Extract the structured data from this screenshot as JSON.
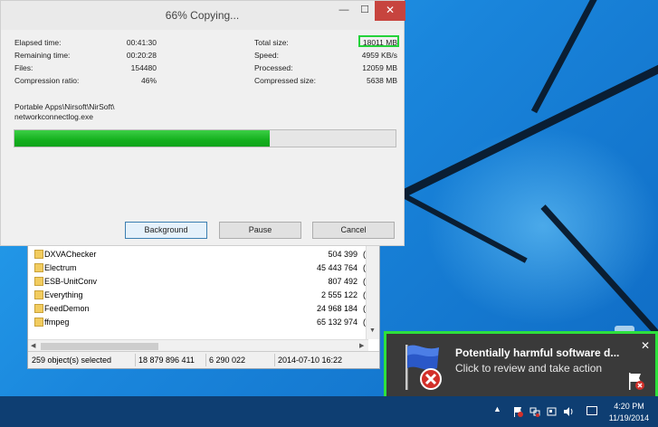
{
  "dialog": {
    "title": "66% Copying...",
    "minimize": "—",
    "maximize": "☐",
    "close": "✕",
    "stats_left": [
      {
        "label": "Elapsed time:",
        "value": "00:41:30"
      },
      {
        "label": "Remaining time:",
        "value": "00:20:28"
      },
      {
        "label": "Files:",
        "value": "154480"
      },
      {
        "label": "Compression ratio:",
        "value": "46%"
      }
    ],
    "stats_right": [
      {
        "label": "Total size:",
        "value": "18011 MB"
      },
      {
        "label": "Speed:",
        "value": "4959 KB/s"
      },
      {
        "label": "Processed:",
        "value": "12059 MB"
      },
      {
        "label": "Compressed size:",
        "value": "5638 MB"
      }
    ],
    "path_line1": "Portable Apps\\Nirsoft\\NirSoft\\",
    "path_line2": "networkconnectlog.exe",
    "progress_fraction": 0.67,
    "progress_color": "#14b01e",
    "highlight_color": "#24d23a",
    "buttons": {
      "background": "Background",
      "pause": "Pause",
      "cancel": "Cancel"
    }
  },
  "explorer": {
    "files": [
      {
        "name": "DXVAChecker",
        "size": "504 399",
        "extra": "("
      },
      {
        "name": "Electrum",
        "size": "45 443 764",
        "extra": "("
      },
      {
        "name": "ESB-UnitConv",
        "size": "807 492",
        "extra": "("
      },
      {
        "name": "Everything",
        "size": "2 555 122",
        "extra": "("
      },
      {
        "name": "FeedDemon",
        "size": "24 968 184",
        "extra": "("
      },
      {
        "name": "ffmpeg",
        "size": "65 132 974",
        "extra": "("
      }
    ],
    "status": {
      "selected": "259 object(s) selected",
      "size": "18 879 896 411",
      "packed": "6 290 022",
      "date": "2014-07-10 16:22"
    }
  },
  "toast": {
    "title": "Potentially harmful software d...",
    "message": "Click to review and take action",
    "close": "✕",
    "border_color": "#2ee03c",
    "icon": "action-center-flag-icon"
  },
  "taskbar": {
    "time": "4:20 PM",
    "date": "11/19/2014",
    "chevron": "▲"
  }
}
